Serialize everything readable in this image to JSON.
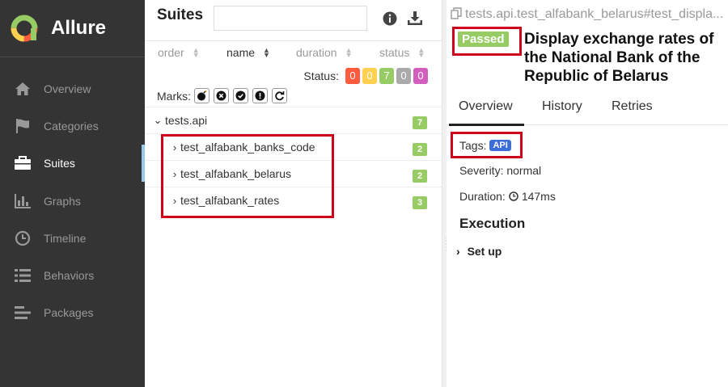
{
  "app": {
    "name": "Allure"
  },
  "sidebar": {
    "items": [
      {
        "label": "Overview"
      },
      {
        "label": "Categories"
      },
      {
        "label": "Suites"
      },
      {
        "label": "Graphs"
      },
      {
        "label": "Timeline"
      },
      {
        "label": "Behaviors"
      },
      {
        "label": "Packages"
      }
    ],
    "active": "Suites"
  },
  "suites": {
    "title": "Suites",
    "search": {
      "value": "",
      "placeholder": ""
    },
    "sort": {
      "order": "order",
      "name": "name",
      "duration": "duration",
      "status": "status",
      "active": "name"
    },
    "status": {
      "label": "Status:",
      "counts": [
        {
          "value": "0",
          "color": "#fd5a3e"
        },
        {
          "value": "0",
          "color": "#ffd050"
        },
        {
          "value": "7",
          "color": "#97cc64"
        },
        {
          "value": "0",
          "color": "#aaaaaa"
        },
        {
          "value": "0",
          "color": "#d35ebe"
        }
      ]
    },
    "marks": {
      "label": "Marks:",
      "icons": [
        "flaky-icon",
        "new-failed-icon",
        "new-passed-icon",
        "new-broken-icon",
        "retries-icon"
      ]
    },
    "tree": {
      "root": {
        "name": "tests.api",
        "count": "7"
      },
      "children": [
        {
          "name": "test_alfabank_banks_code",
          "count": "2"
        },
        {
          "name": "test_alfabank_belarus",
          "count": "2"
        },
        {
          "name": "test_alfabank_rates",
          "count": "3"
        }
      ]
    }
  },
  "test": {
    "path": "tests.api.test_alfabank_belarus#test_displa...",
    "status": "Passed",
    "title": "Display exchange rates of the National Bank of the Republic of Belarus",
    "tabs": [
      "Overview",
      "History",
      "Retries"
    ],
    "tags_label": "Tags:",
    "tag": "API",
    "severity": "Severity: normal",
    "duration_label": "Duration:",
    "duration": "147ms",
    "execution": "Execution",
    "setup": "Set up"
  },
  "colors": {
    "sidebar_bg": "#343434",
    "passed": "#97cc64",
    "highlight": "#d0021b",
    "tag": "#3d6dd6"
  }
}
